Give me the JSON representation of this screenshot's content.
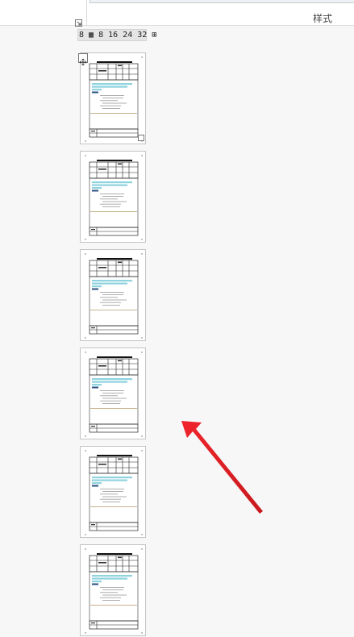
{
  "ribbon": {
    "styles_group_label": "样式"
  },
  "thumbnail_toolbar": {
    "text": "8 ▦ 8 16 24 32 ⊞"
  },
  "thumbnails": {
    "count_visible": 6
  },
  "icons": {
    "dialog_launcher": "dialog-launcher-icon",
    "move_handle": "move-handle-icon",
    "resize_handle": "resize-handle-icon",
    "annotation_arrow": "red-arrow-icon"
  },
  "colors": {
    "highlight": "#8fd3df",
    "arrow": "#e8242a",
    "background": "#f7f7f7"
  }
}
